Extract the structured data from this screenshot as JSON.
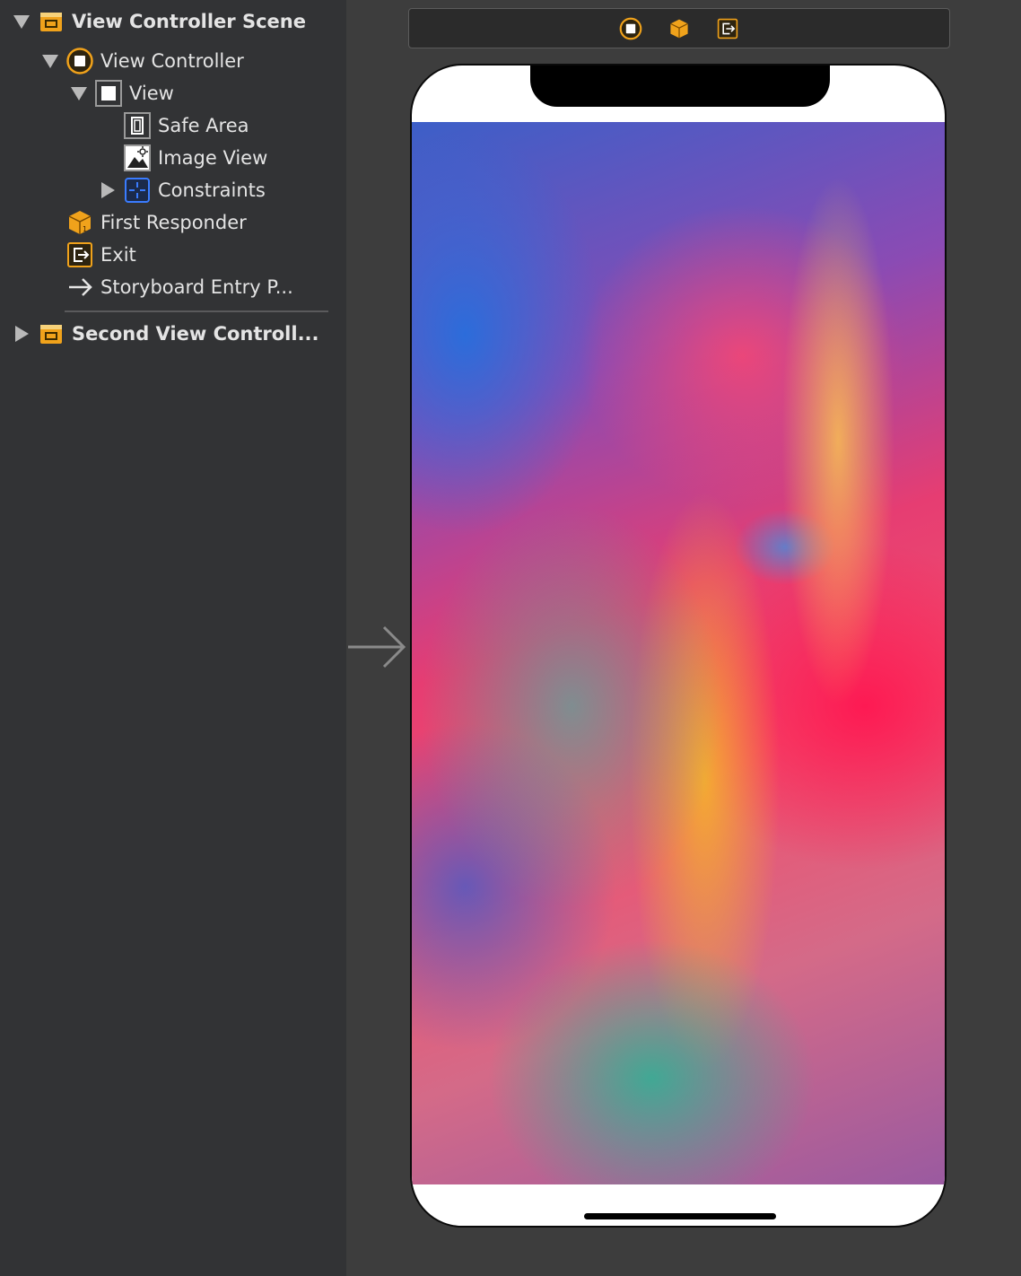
{
  "outline": {
    "items": [
      {
        "label": "View Controller Scene",
        "icon": "scene-icon",
        "disclosure": "expanded"
      },
      {
        "label": "View Controller",
        "icon": "view-controller-icon",
        "disclosure": "expanded"
      },
      {
        "label": "View",
        "icon": "view-icon",
        "disclosure": "expanded"
      },
      {
        "label": "Safe Area",
        "icon": "safe-area-icon"
      },
      {
        "label": "Image View",
        "icon": "image-view-icon"
      },
      {
        "label": "Constraints",
        "icon": "constraints-icon",
        "disclosure": "collapsed"
      },
      {
        "label": "First Responder",
        "icon": "first-responder-icon"
      },
      {
        "label": "Exit",
        "icon": "exit-icon"
      },
      {
        "label": "Storyboard Entry P...",
        "icon": "entry-point-arrow-icon"
      },
      {
        "label": "Second View Controll...",
        "icon": "scene-icon",
        "disclosure": "collapsed"
      }
    ]
  },
  "canvas": {
    "scene_dock_icons": [
      "view-controller-icon",
      "first-responder-icon",
      "exit-icon"
    ],
    "device": "iPhone with notch",
    "content": "image-view"
  },
  "colors": {
    "sidebar_bg": "#323335",
    "canvas_bg": "#3d3d3d",
    "accent_orange": "#f0a21b",
    "constraints_blue": "#3a7cff"
  }
}
